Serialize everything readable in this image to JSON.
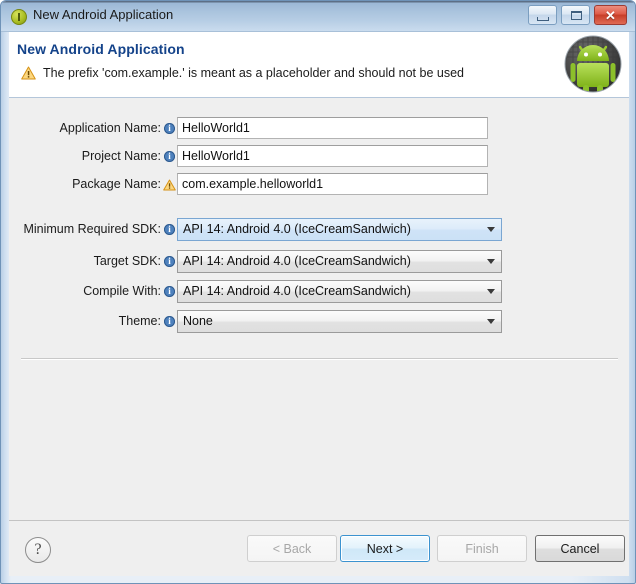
{
  "window": {
    "title": "New Android Application",
    "title_icon": "eclipse-wizard-icon",
    "controls": {
      "minimize": "minimize-icon",
      "maximize": "maximize-icon",
      "close": "✕"
    }
  },
  "header": {
    "title": "New Android Application",
    "message_icon": "warning-icon",
    "message": "The prefix 'com.example.' is meant as a placeholder and should not be used",
    "logo": "android-robot-icon"
  },
  "form": {
    "text_fields": [
      {
        "label": "Application Name:",
        "icon": "info-icon",
        "value": "HelloWorld1",
        "placeholder": ""
      },
      {
        "label": "Project Name:",
        "icon": "info-icon",
        "value": "HelloWorld1",
        "placeholder": ""
      },
      {
        "label": "Package Name:",
        "icon": "warning-icon",
        "value": "com.example.helloworld1",
        "placeholder": ""
      }
    ],
    "combos": [
      {
        "label": "Minimum Required SDK:",
        "icon": "info-icon",
        "value": "API 14: Android 4.0 (IceCreamSandwich)",
        "selected": true
      },
      {
        "label": "Target SDK:",
        "icon": "info-icon",
        "value": "API 14: Android 4.0 (IceCreamSandwich)",
        "selected": false
      },
      {
        "label": "Compile With:",
        "icon": "info-icon",
        "value": "API 14: Android 4.0 (IceCreamSandwich)",
        "selected": false
      },
      {
        "label": "Theme:",
        "icon": "info-icon",
        "value": "None",
        "selected": false
      }
    ]
  },
  "footer": {
    "help_label": "?",
    "buttons": [
      {
        "label": "< Back",
        "state": "disabled"
      },
      {
        "label": "Next >",
        "state": "focused"
      },
      {
        "label": "Finish",
        "state": "disabled"
      },
      {
        "label": "Cancel",
        "state": "enabled"
      }
    ]
  },
  "colors": {
    "accent": "#14438a",
    "titlebar": "#a9c3dd",
    "warning": "#f0a30a",
    "info": "#4e81bd",
    "body_bg": "#efefef"
  }
}
